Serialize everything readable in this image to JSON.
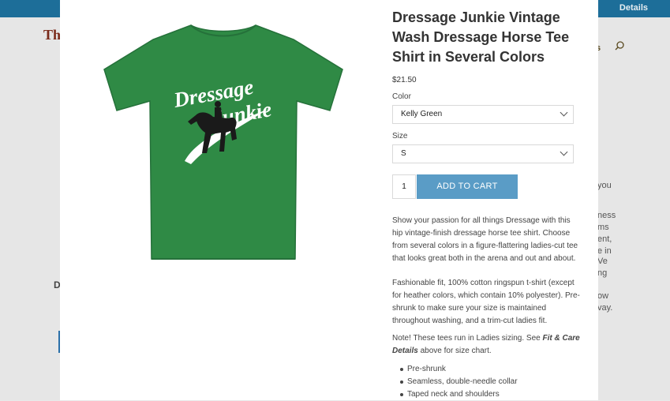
{
  "background": {
    "topbar_link": "Details",
    "logo": "Th",
    "cart_fragment": "s",
    "text_fragments": [
      "you",
      "ness",
      "ms",
      "ent,",
      "e in",
      "Ve",
      "ng",
      "ow",
      "vay."
    ],
    "side_letter": "D"
  },
  "product": {
    "title": "Dressage Junkie Vintage Wash Dressage Horse Tee Shirt in Several Colors",
    "price": "$21.50",
    "color_label": "Color",
    "color_value": "Kelly Green",
    "size_label": "Size",
    "size_value": "S",
    "quantity": "1",
    "add_to_cart": "ADD TO CART",
    "shirt_text_line1": "Dressage",
    "shirt_text_line2": "Junkie",
    "shirt_color": "#2f8a45",
    "description_1": "Show your passion for all things Dressage with this hip vintage-finish dressage horse tee shirt. Choose from several colors in a figure-flattering ladies-cut tee that looks great both in the arena and out and about.",
    "description_2": "Fashionable fit, 100% cotton ringspun t-shirt (except for heather colors, which contain 10% polyester). Pre-shrunk to make sure your size is maintained throughout washing, and a trim-cut ladies fit.",
    "note_prefix": "Note! These tees run in Ladies sizing. See ",
    "note_link": "Fit & Care Details",
    "note_suffix": " above for size chart.",
    "bullets": [
      "Pre-shrunk",
      "Seamless, double-needle collar",
      "Taped neck and shoulders"
    ]
  }
}
